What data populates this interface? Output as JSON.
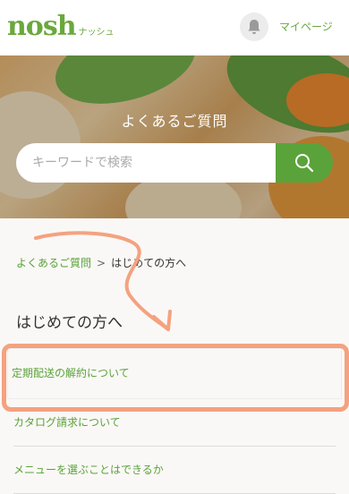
{
  "header": {
    "logo_main": "nosh",
    "logo_sub": "ナッシュ",
    "icon_bell": "bell-icon",
    "mypage_label": "マイページ"
  },
  "hero": {
    "title": "よくあるご質問",
    "search_placeholder": "キーワードで検索",
    "search_value": "",
    "search_icon": "search-icon"
  },
  "breadcrumb": {
    "items": [
      {
        "label": "よくあるご質問"
      },
      {
        "label": "はじめての方へ"
      }
    ],
    "separator": ">"
  },
  "page_title": "はじめての方へ",
  "faq": [
    {
      "label": "定期配送の解約について"
    },
    {
      "label": "カタログ請求について"
    },
    {
      "label": "メニューを選ぶことはできるか"
    }
  ],
  "colors": {
    "brand_green": "#5aa33a",
    "annotation": "#f4a27f"
  }
}
